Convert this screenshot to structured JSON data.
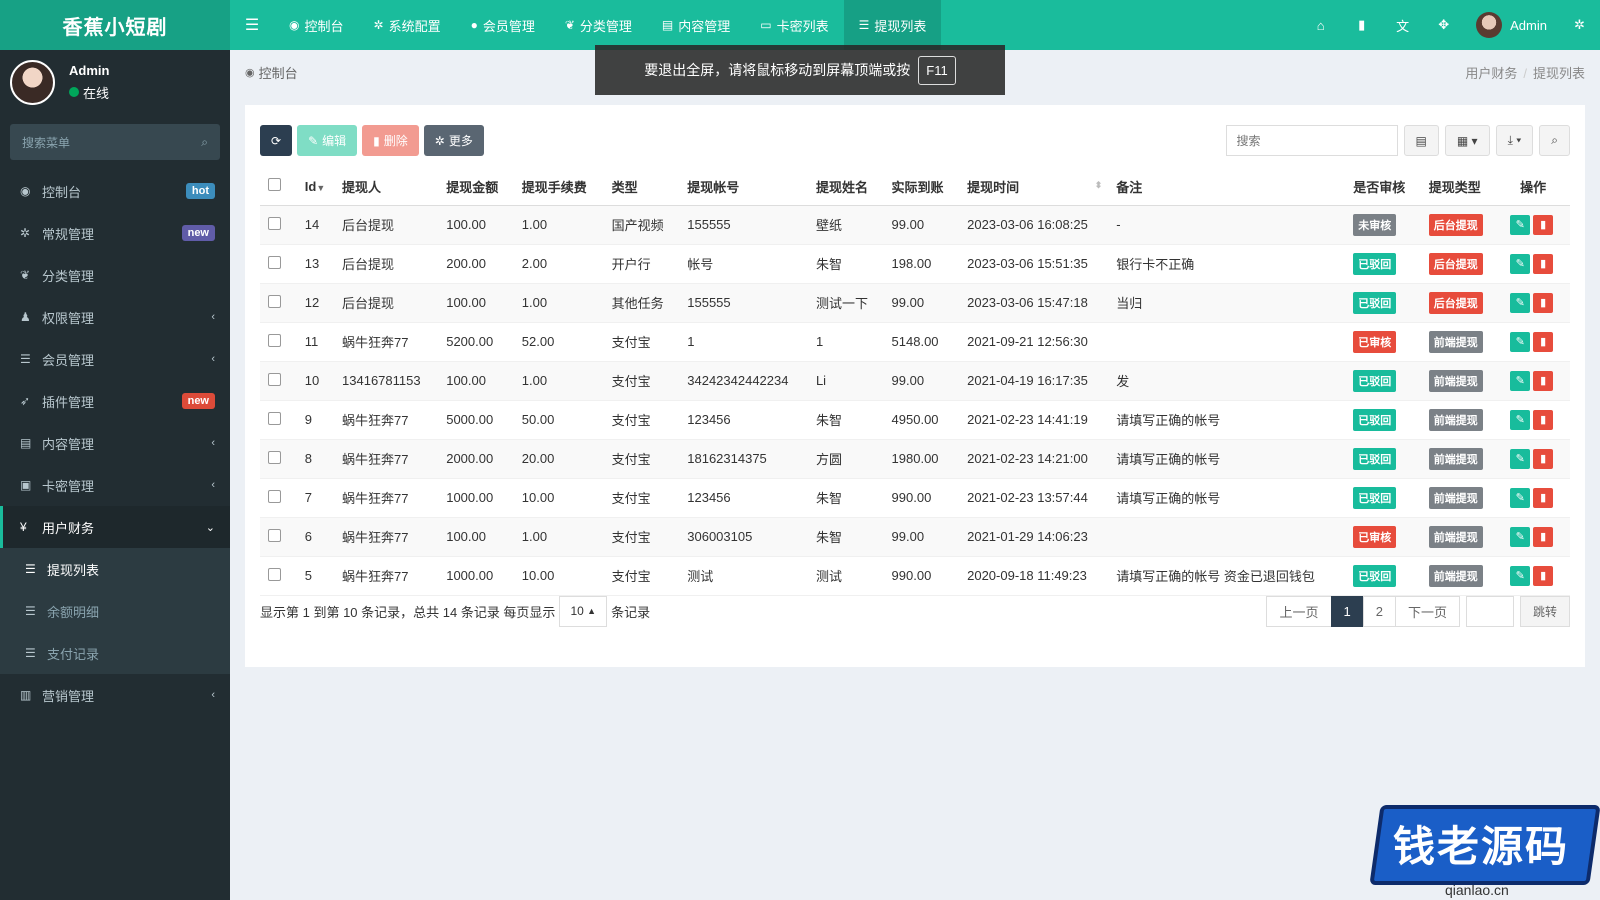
{
  "app": {
    "logo": "香蕉小短剧"
  },
  "topnav": [
    {
      "icon": "dashboard-icon",
      "glyph": "◉",
      "label": "控制台"
    },
    {
      "icon": "cogs-icon",
      "glyph": "✲",
      "label": "系统配置"
    },
    {
      "icon": "user-icon",
      "glyph": "●",
      "label": "会员管理"
    },
    {
      "icon": "leaf-icon",
      "glyph": "❦",
      "label": "分类管理"
    },
    {
      "icon": "file-icon",
      "glyph": "▤",
      "label": "内容管理"
    },
    {
      "icon": "card-icon",
      "glyph": "▭",
      "label": "卡密列表"
    },
    {
      "icon": "list-icon",
      "glyph": "☰",
      "label": "提现列表"
    }
  ],
  "header": {
    "user_name": "Admin"
  },
  "sidebar": {
    "user": {
      "name": "Admin",
      "status": "在线"
    },
    "search_placeholder": "搜索菜单",
    "items": [
      {
        "label": "控制台",
        "badge": "hot",
        "icon": "dashboard-icon",
        "glyph": "◉"
      },
      {
        "label": "常规管理",
        "badge": "new",
        "icon": "cogs-icon",
        "glyph": "✲"
      },
      {
        "label": "分类管理",
        "badge": "",
        "icon": "leaf-icon",
        "glyph": "❦"
      },
      {
        "label": "权限管理",
        "badge": "",
        "icon": "group-icon",
        "glyph": "♟"
      },
      {
        "label": "会员管理",
        "badge": "",
        "icon": "list-icon",
        "glyph": "☰"
      },
      {
        "label": "插件管理",
        "badge": "new",
        "icon": "rocket-icon",
        "glyph": "➶"
      },
      {
        "label": "内容管理",
        "badge": "",
        "icon": "file-icon",
        "glyph": "▤"
      },
      {
        "label": "卡密管理",
        "badge": "",
        "icon": "image-icon",
        "glyph": "▣"
      },
      {
        "label": "用户财务",
        "badge": "",
        "icon": "yen-icon",
        "glyph": "¥"
      },
      {
        "label": "提现列表",
        "badge": "",
        "icon": "list-icon",
        "glyph": "☰"
      },
      {
        "label": "余额明细",
        "badge": "",
        "icon": "list-icon",
        "glyph": "☰"
      },
      {
        "label": "支付记录",
        "badge": "",
        "icon": "list-icon",
        "glyph": "☰"
      },
      {
        "label": "营销管理",
        "badge": "",
        "icon": "chart-icon",
        "glyph": "▥"
      }
    ]
  },
  "content": {
    "home_label": "控制台",
    "breadcrumb": [
      "用户财务",
      "提现列表"
    ]
  },
  "toast": {
    "text": "要退出全屏，请将鼠标移动到屏幕顶端或按",
    "key": "F11"
  },
  "toolbar": {
    "edit": "编辑",
    "delete": "删除",
    "more": "更多",
    "search_placeholder": "搜索"
  },
  "table": {
    "columns": [
      "Id",
      "提现人",
      "提现金额",
      "提现手续费",
      "类型",
      "提现帐号",
      "提现姓名",
      "实际到账",
      "提现时间",
      "备注",
      "是否审核",
      "提现类型",
      "操作"
    ],
    "rows": [
      {
        "id": "14",
        "user": "后台提现",
        "amount": "100.00",
        "fee": "1.00",
        "type": "国产视频",
        "account": "155555",
        "name": "壁纸",
        "actual": "99.00",
        "time": "2023-03-06 16:08:25",
        "remark": "-",
        "audit": "未审核",
        "audit_color": "gray",
        "wtype": "后台提现",
        "wtype_color": "red"
      },
      {
        "id": "13",
        "user": "后台提现",
        "amount": "200.00",
        "fee": "2.00",
        "type": "开户行",
        "account": "帐号",
        "name": "朱智",
        "actual": "198.00",
        "time": "2023-03-06 15:51:35",
        "remark": "银行卡不正确",
        "audit": "已驳回",
        "audit_color": "green",
        "wtype": "后台提现",
        "wtype_color": "red"
      },
      {
        "id": "12",
        "user": "后台提现",
        "amount": "100.00",
        "fee": "1.00",
        "type": "其他任务",
        "account": "155555",
        "name": "测试一下",
        "actual": "99.00",
        "time": "2023-03-06 15:47:18",
        "remark": "当归",
        "audit": "已驳回",
        "audit_color": "green",
        "wtype": "后台提现",
        "wtype_color": "red"
      },
      {
        "id": "11",
        "user": "蜗牛狂奔77",
        "amount": "5200.00",
        "fee": "52.00",
        "type": "支付宝",
        "account": "1",
        "name": "1",
        "actual": "5148.00",
        "time": "2021-09-21 12:56:30",
        "remark": "",
        "audit": "已审核",
        "audit_color": "red",
        "wtype": "前端提现",
        "wtype_color": "gray"
      },
      {
        "id": "10",
        "user": "13416781153",
        "amount": "100.00",
        "fee": "1.00",
        "type": "支付宝",
        "account": "34242342442234",
        "name": "Li",
        "actual": "99.00",
        "time": "2021-04-19 16:17:35",
        "remark": "发",
        "audit": "已驳回",
        "audit_color": "green",
        "wtype": "前端提现",
        "wtype_color": "gray"
      },
      {
        "id": "9",
        "user": "蜗牛狂奔77",
        "amount": "5000.00",
        "fee": "50.00",
        "type": "支付宝",
        "account": "123456",
        "name": "朱智",
        "actual": "4950.00",
        "time": "2021-02-23 14:41:19",
        "remark": "请填写正确的帐号",
        "audit": "已驳回",
        "audit_color": "green",
        "wtype": "前端提现",
        "wtype_color": "gray"
      },
      {
        "id": "8",
        "user": "蜗牛狂奔77",
        "amount": "2000.00",
        "fee": "20.00",
        "type": "支付宝",
        "account": "18162314375",
        "name": "方圆",
        "actual": "1980.00",
        "time": "2021-02-23 14:21:00",
        "remark": "请填写正确的帐号",
        "audit": "已驳回",
        "audit_color": "green",
        "wtype": "前端提现",
        "wtype_color": "gray"
      },
      {
        "id": "7",
        "user": "蜗牛狂奔77",
        "amount": "1000.00",
        "fee": "10.00",
        "type": "支付宝",
        "account": "123456",
        "name": "朱智",
        "actual": "990.00",
        "time": "2021-02-23 13:57:44",
        "remark": "请填写正确的帐号",
        "audit": "已驳回",
        "audit_color": "green",
        "wtype": "前端提现",
        "wtype_color": "gray"
      },
      {
        "id": "6",
        "user": "蜗牛狂奔77",
        "amount": "100.00",
        "fee": "1.00",
        "type": "支付宝",
        "account": "306003105",
        "name": "朱智",
        "actual": "99.00",
        "time": "2021-01-29 14:06:23",
        "remark": "",
        "audit": "已审核",
        "audit_color": "red",
        "wtype": "前端提现",
        "wtype_color": "gray"
      },
      {
        "id": "5",
        "user": "蜗牛狂奔77",
        "amount": "1000.00",
        "fee": "10.00",
        "type": "支付宝",
        "account": "测试",
        "name": "测试",
        "actual": "990.00",
        "time": "2020-09-18 11:49:23",
        "remark": "请填写正确的帐号 资金已退回钱包",
        "audit": "已驳回",
        "audit_color": "green",
        "wtype": "前端提现",
        "wtype_color": "gray"
      }
    ]
  },
  "pagination": {
    "summary": "显示第 1 到第 10 条记录，总共 14 条记录 每页显示",
    "page_size": "10",
    "suffix": "条记录",
    "prev": "上一页",
    "pages": [
      "1",
      "2"
    ],
    "current": "1",
    "next": "下一页",
    "jump": "跳转"
  },
  "watermark": {
    "text": "钱老源码",
    "url": "qianlao.cn"
  },
  "colors": {
    "header": "#1abc9c",
    "logo_bg": "#17a185",
    "sidebar": "#222d32",
    "primary_dark": "#2c3e50",
    "success": "#18bc9c",
    "danger": "#e74c3c"
  }
}
